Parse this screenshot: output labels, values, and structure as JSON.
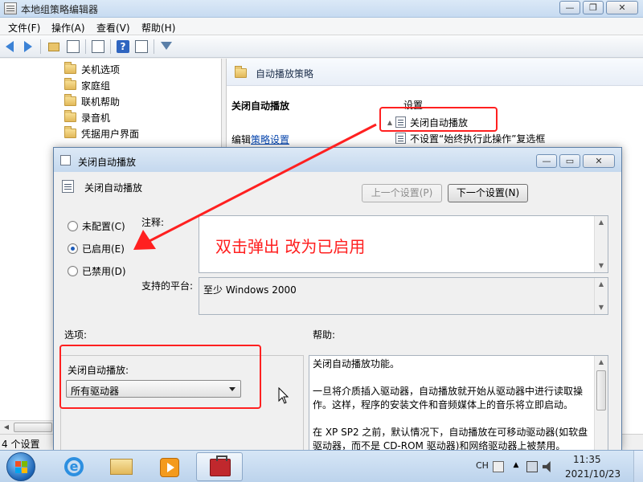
{
  "main_window": {
    "title": "本地组策略编辑器",
    "window_buttons": {
      "minimize": "—",
      "maximize": "❐",
      "close": "✕"
    },
    "menu": [
      "文件(F)",
      "操作(A)",
      "查看(V)",
      "帮助(H)"
    ],
    "tree_items": [
      "关机选项",
      "家庭组",
      "联机帮助",
      "录音机",
      "凭据用户界面"
    ],
    "right_header": "自动播放策略",
    "policy_name": "关闭自动播放",
    "edit_prefix": "编辑",
    "edit_link": "策略设置",
    "settings_column": "设置",
    "settings_rows": [
      "关闭自动播放",
      "不设置“始终执行此操作”复选框"
    ],
    "status": "4 个设置"
  },
  "dialog": {
    "title": "关闭自动播放",
    "window_buttons": {
      "minimize": "—",
      "maximize": "▭",
      "close": "✕"
    },
    "header_title": "关闭自动播放",
    "prev_button": "上一个设置(P)",
    "next_button": "下一个设置(N)",
    "radio_options": [
      {
        "label": "未配置(C)",
        "checked": false
      },
      {
        "label": "已启用(E)",
        "checked": true
      },
      {
        "label": "已禁用(D)",
        "checked": false
      }
    ],
    "comment_label": "注释:",
    "platform_label": "支持的平台:",
    "platform_value": "至少 Windows 2000",
    "options_label": "选项:",
    "help_label": "帮助:",
    "option_field_label": "关闭自动播放:",
    "option_select_value": "所有驱动器",
    "help_paragraphs": [
      "关闭自动播放功能。",
      "一旦将介质插入驱动器，自动播放就开始从驱动器中进行读取操作。这样，程序的安装文件和音频媒体上的音乐将立即启动。",
      "在 XP SP2 之前，默认情况下，自动播放在可移动驱动器(如软盘驱动器，而不是 CD-ROM 驱动器)和网络驱动器上被禁用。"
    ]
  },
  "annotation": {
    "text": "双击弹出 改为已启用",
    "color": "#ff2020"
  },
  "taskbar": {
    "ime": "CH",
    "time": "11:35",
    "date": "2021/10/23"
  },
  "colors": {
    "accent": "#3b82d6",
    "annotation_red": "#ff2020",
    "link": "#0645ad"
  }
}
